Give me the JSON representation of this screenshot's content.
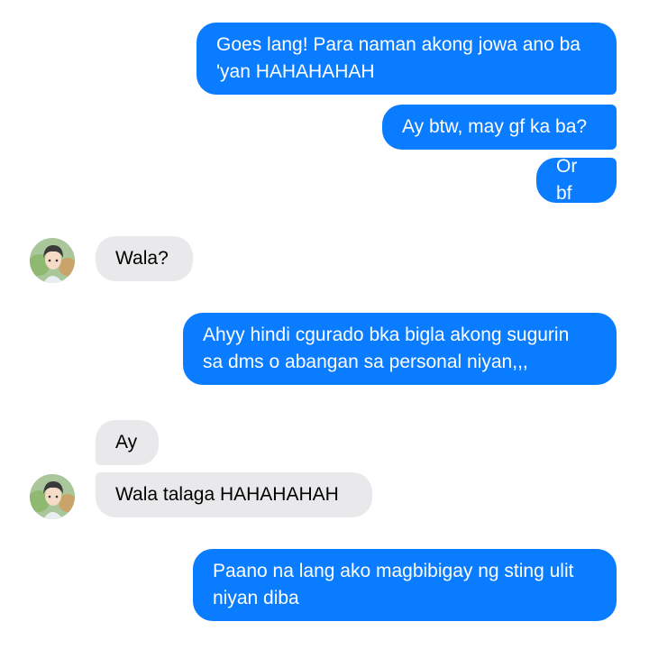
{
  "thread": {
    "messages": [
      {
        "from": "me",
        "text": "Goes lang! Para naman akong jowa ano ba\n'yan HAHAHAHAH"
      },
      {
        "from": "me",
        "text": "Ay btw, may gf ka ba?"
      },
      {
        "from": "me",
        "text": "Or bf"
      },
      {
        "from": "them",
        "text": "Wala?"
      },
      {
        "from": "me",
        "text": "Ahyy hindi cgurado bka bigla akong sugurin\nsa dms o abangan sa personal niyan,,,"
      },
      {
        "from": "them",
        "text": "Ay"
      },
      {
        "from": "them",
        "text": "Wala talaga HAHAHAHAH"
      },
      {
        "from": "me",
        "text": "Paano na lang ako magbibigay ng sting ulit\nniyan diba"
      }
    ]
  },
  "colors": {
    "sent_bubble": "#0a7cff",
    "received_bubble": "#e9e9eb",
    "background": "#ffffff"
  },
  "icons": {
    "contact_avatar": "anime-character-avatar-icon"
  }
}
